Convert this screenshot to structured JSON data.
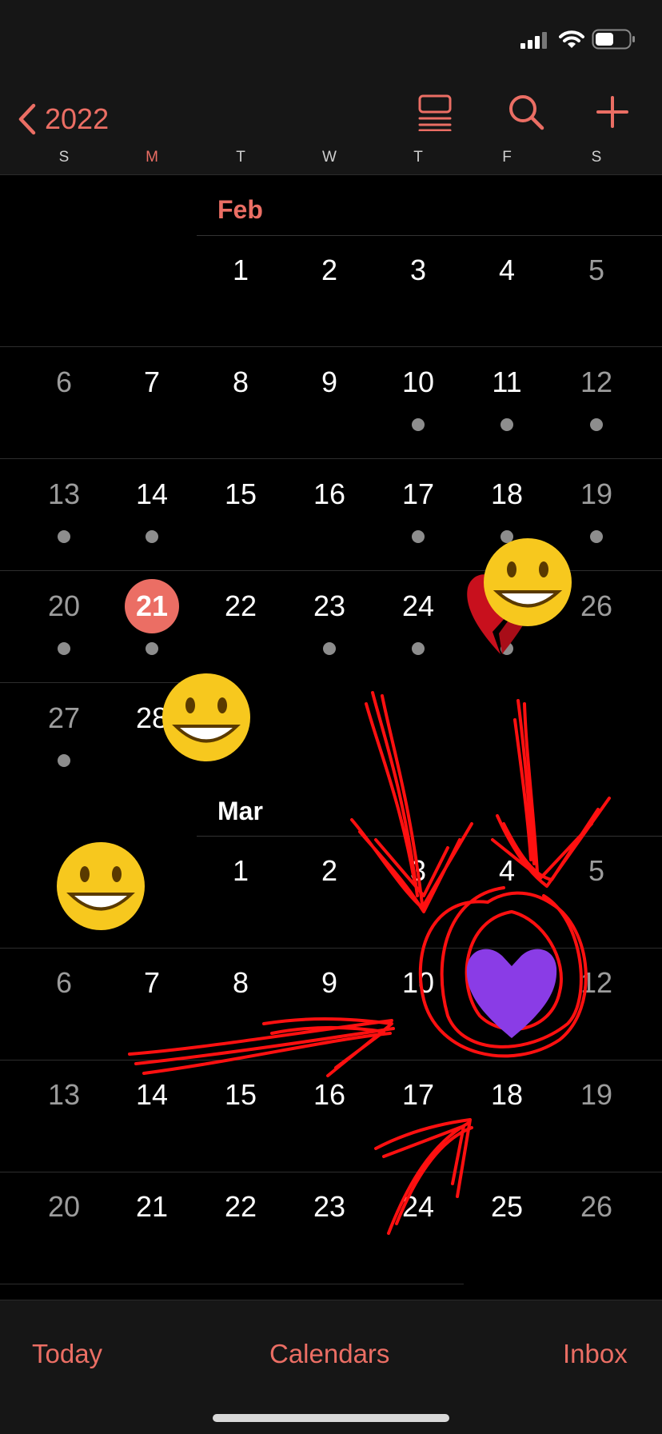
{
  "nav": {
    "back_label": "2022"
  },
  "weekdays": [
    "S",
    "M",
    "T",
    "W",
    "T",
    "F",
    "S"
  ],
  "months": {
    "feb": "Feb",
    "mar": "Mar"
  },
  "feb": {
    "w1": [
      "1",
      "2",
      "3",
      "4",
      "5"
    ],
    "w2": [
      "6",
      "7",
      "8",
      "9",
      "10",
      "11",
      "12"
    ],
    "w3": [
      "13",
      "14",
      "15",
      "16",
      "17",
      "18",
      "19"
    ],
    "w4": [
      "20",
      "21",
      "22",
      "23",
      "24",
      "",
      "26"
    ],
    "w5": [
      "27",
      "28"
    ]
  },
  "mar": {
    "w1": [
      "1",
      "2",
      "3",
      "4",
      "5"
    ],
    "w2": [
      "6",
      "7",
      "8",
      "9",
      "10",
      "",
      "12"
    ],
    "w3": [
      "13",
      "14",
      "15",
      "16",
      "17",
      "18",
      "19"
    ],
    "w4": [
      "20",
      "21",
      "22",
      "23",
      "24",
      "25",
      "26"
    ]
  },
  "tabs": {
    "today": "Today",
    "calendars": "Calendars",
    "inbox": "Inbox"
  },
  "colors": {
    "accent": "#eb6e64",
    "background": "#000000",
    "bar": "#161616",
    "event_dot": "#8d8d8d"
  }
}
